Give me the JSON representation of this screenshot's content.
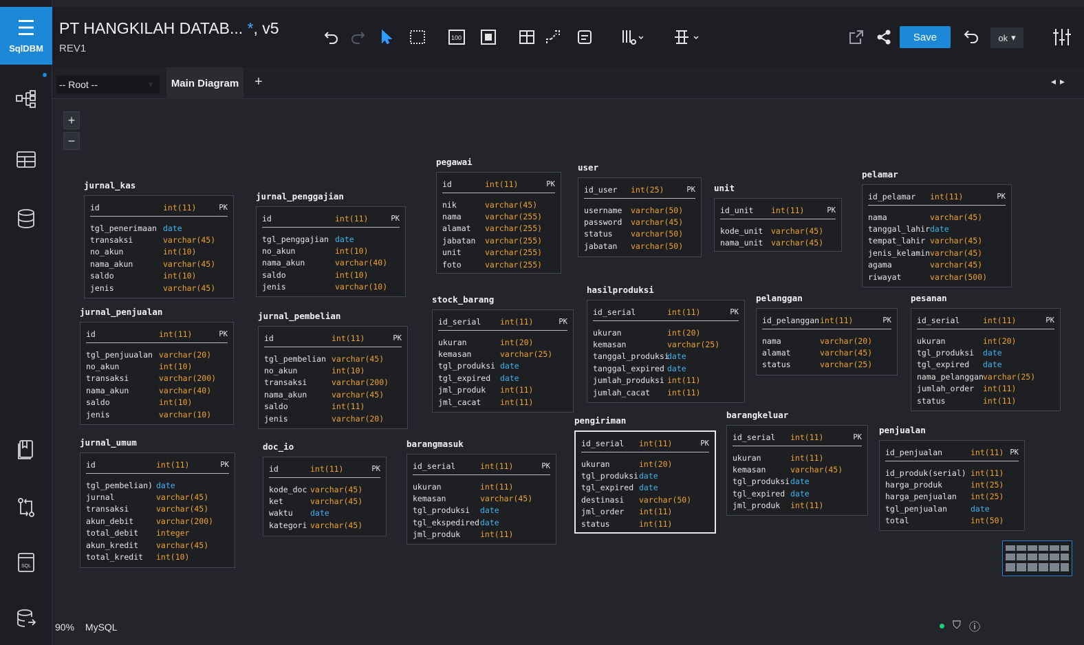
{
  "app": {
    "logo_text": "SqlDBM"
  },
  "header": {
    "title": "PT HANGKILAH DATAB...",
    "unsaved_mark": "*",
    "version": ", v5",
    "subtitle": "REV1",
    "save_label": "Save",
    "ok_label": "ok"
  },
  "tabs": {
    "root_label": "-- Root --",
    "main_label": "Main Diagram",
    "add_label": "+"
  },
  "zoom": {
    "plus": "+",
    "minus": "−"
  },
  "status": {
    "zoom_level": "90%",
    "db_type": "MySQL"
  },
  "colors": {
    "accent": "#1e88d8",
    "type": "#f0a32c",
    "date": "#3db3ef"
  },
  "tables": [
    {
      "name": "jurnal_kas",
      "pk": [
        "id",
        "int(11)"
      ],
      "cols": [
        [
          "tgl_penerimaan",
          "date"
        ],
        [
          "transaksi",
          "varchar(45)"
        ],
        [
          "no_akun",
          "int(10)"
        ],
        [
          "nama_akun",
          "varchar(45)"
        ],
        [
          "saldo",
          "int(10)"
        ],
        [
          "jenis",
          "varchar(45)"
        ]
      ]
    },
    {
      "name": "jurnal_penggajian",
      "pk": [
        "id",
        "int(11)"
      ],
      "cols": [
        [
          "tgl_penggajian",
          "date"
        ],
        [
          "no_akun",
          "int(10)"
        ],
        [
          "nama_akun",
          "varchar(40)"
        ],
        [
          "saldo",
          "int(10)"
        ],
        [
          "jenis",
          "varchar(10)"
        ]
      ]
    },
    {
      "name": "pegawai",
      "pk": [
        "id",
        "int(11)"
      ],
      "cols": [
        [
          "nik",
          "varchar(45)"
        ],
        [
          "nama",
          "varchar(255)"
        ],
        [
          "alamat",
          "varchar(255)"
        ],
        [
          "jabatan",
          "varchar(255)"
        ],
        [
          "unit",
          "varchar(255)"
        ],
        [
          "foto",
          "varchar(255)"
        ]
      ]
    },
    {
      "name": "user",
      "pk": [
        "id_user",
        "int(25)"
      ],
      "cols": [
        [
          "username",
          "varchar(50)"
        ],
        [
          "password",
          "varchar(45)"
        ],
        [
          "status",
          "varchar(50)"
        ],
        [
          "jabatan",
          "varchar(50)"
        ]
      ]
    },
    {
      "name": "unit",
      "pk": [
        "id_unit",
        "int(11)"
      ],
      "cols": [
        [
          "kode_unit",
          "varchar(45)"
        ],
        [
          "nama_unit",
          "varchar(45)"
        ]
      ]
    },
    {
      "name": "pelamar",
      "pk": [
        "id_pelamar",
        "int(11)"
      ],
      "cols": [
        [
          "nama",
          "varchar(45)"
        ],
        [
          "tanggal_lahir",
          "date"
        ],
        [
          "tempat_lahir",
          "varchar(45)"
        ],
        [
          "jenis_kelamin",
          "varchar(45)"
        ],
        [
          "agama",
          "varchar(45)"
        ],
        [
          "riwayat",
          "varchar(500)"
        ]
      ]
    },
    {
      "name": "jurnal_penjualan",
      "pk": [
        "id",
        "int(11)"
      ],
      "cols": [
        [
          "tgl_penjuualan",
          "varchar(20)"
        ],
        [
          "no_akun",
          "int(10)"
        ],
        [
          "transaksi",
          "varchar(200)"
        ],
        [
          "nama_akun",
          "varchar(40)"
        ],
        [
          "saldo",
          "int(10)"
        ],
        [
          "jenis",
          "varchar(10)"
        ]
      ]
    },
    {
      "name": "jurnal_pembelian",
      "pk": [
        "id",
        "int(11)"
      ],
      "cols": [
        [
          "tgl_pembelian",
          "varchar(45)"
        ],
        [
          "no_akun",
          "int(10)"
        ],
        [
          "transaksi",
          "varchar(200)"
        ],
        [
          "nama_akun",
          "varchar(45)"
        ],
        [
          "saldo",
          "int(11)"
        ],
        [
          "jenis",
          "varchar(20)"
        ]
      ]
    },
    {
      "name": "stock_barang",
      "pk": [
        "id_serial",
        "int(11)"
      ],
      "cols": [
        [
          "ukuran",
          "int(20)"
        ],
        [
          "kemasan",
          "varchar(25)"
        ],
        [
          "tgl_produksi",
          "date"
        ],
        [
          "tgl_expired",
          "date"
        ],
        [
          "jml_produk",
          "int(11)"
        ],
        [
          "jml_cacat",
          "int(11)"
        ]
      ]
    },
    {
      "name": "hasilproduksi",
      "pk": [
        "id_serial",
        "int(11)"
      ],
      "cols": [
        [
          "ukuran",
          "int(20)"
        ],
        [
          "kemasan",
          "varchar(25)"
        ],
        [
          "tanggal_produksi",
          "date"
        ],
        [
          "tanggal_expired",
          "date"
        ],
        [
          "jumlah_produksi",
          "int(11)"
        ],
        [
          "jumlah_cacat",
          "int(11)"
        ]
      ]
    },
    {
      "name": "pelanggan",
      "pk": [
        "id_pelanggan",
        "int(11)"
      ],
      "cols": [
        [
          "nama",
          "varchar(20)"
        ],
        [
          "alamat",
          "varchar(45)"
        ],
        [
          "status",
          "varchar(25)"
        ]
      ]
    },
    {
      "name": "pesanan",
      "pk": [
        "id_serial",
        "int(11)"
      ],
      "cols": [
        [
          "ukuran",
          "int(20)"
        ],
        [
          "tgl_produksi",
          "date"
        ],
        [
          "tgl_expired",
          "date"
        ],
        [
          "nama_pelanggan",
          "varchar(25)"
        ],
        [
          "jumlah_order",
          "int(11)"
        ],
        [
          "status",
          "int(11)"
        ]
      ]
    },
    {
      "name": "jurnal_umum",
      "pk": [
        "id",
        "int(11)"
      ],
      "cols": [
        [
          "tgl_pembelian)",
          "date"
        ],
        [
          "jurnal",
          "varchar(45)"
        ],
        [
          "transaksi",
          "varchar(45)"
        ],
        [
          "akun_debit",
          "varchar(200)"
        ],
        [
          "total_debit",
          "integer"
        ],
        [
          "akun_kredit",
          "varchar(45)"
        ],
        [
          "total_kredit",
          "int(10)"
        ]
      ]
    },
    {
      "name": "doc_io",
      "pk": [
        "id",
        "int(11)"
      ],
      "cols": [
        [
          "kode_doc",
          "varchar(45)"
        ],
        [
          "ket",
          "varchar(45)"
        ],
        [
          "waktu",
          "date"
        ],
        [
          "kategori",
          "varchar(45)"
        ]
      ]
    },
    {
      "name": "barangmasuk",
      "pk": [
        "id_serial",
        "int(11)"
      ],
      "cols": [
        [
          "ukuran",
          "int(11)"
        ],
        [
          "kemasan",
          "varchar(45)"
        ],
        [
          "tgl_produksi",
          "date"
        ],
        [
          "tgl_ekspedired",
          "date"
        ],
        [
          "jml_produk",
          "int(11)"
        ]
      ]
    },
    {
      "name": "pengiriman",
      "pk": [
        "id_serial",
        "int(11)"
      ],
      "cols": [
        [
          "ukuran",
          "int(20)"
        ],
        [
          "tgl_produksi",
          "date"
        ],
        [
          "tgl_expired",
          "date"
        ],
        [
          "destinasi",
          "varchar(50)"
        ],
        [
          "jml_order",
          "int(11)"
        ],
        [
          "status",
          "int(11)"
        ]
      ]
    },
    {
      "name": "barangkeluar",
      "pk": [
        "id_serial",
        "int(11)"
      ],
      "cols": [
        [
          "ukuran",
          "int(11)"
        ],
        [
          "kemasan",
          "varchar(45)"
        ],
        [
          "tgl_produksi",
          "date"
        ],
        [
          "tgl_expired",
          "date"
        ],
        [
          "jml_produk",
          "int(11)"
        ]
      ]
    },
    {
      "name": "penjualan",
      "pk": [
        "id_penjualan",
        "int(11)"
      ],
      "cols": [
        [
          "id_produk(serial)",
          "int(11)"
        ],
        [
          "harga_produk",
          "int(25)"
        ],
        [
          "harga_penjualan",
          "int(25)"
        ],
        [
          "tgl_penjualan",
          "date"
        ],
        [
          "total",
          "int(50)"
        ]
      ]
    }
  ],
  "pk_label": "PK"
}
